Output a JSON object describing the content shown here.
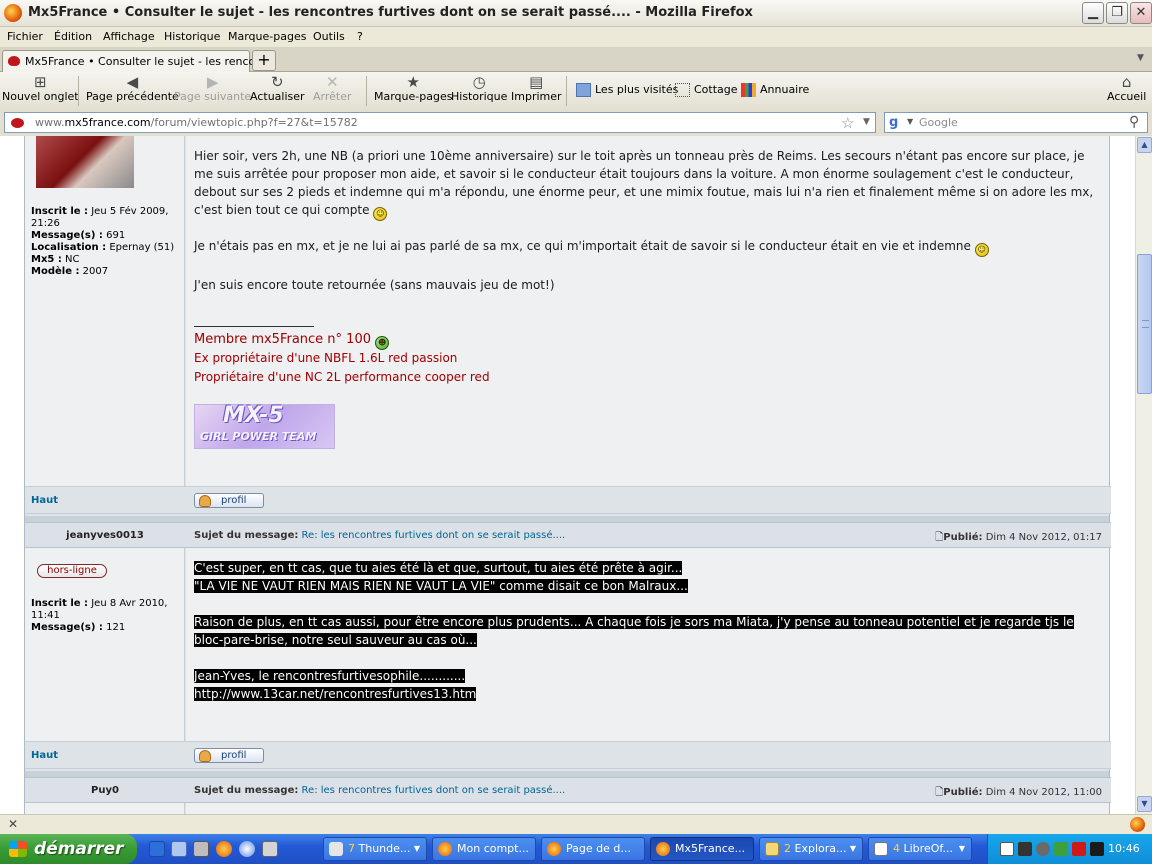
{
  "window": {
    "title": "Mx5France • Consulter le sujet - les rencontres furtives dont on se serait passé.... - Mozilla Firefox"
  },
  "menu": [
    "Fichier",
    "Édition",
    "Affichage",
    "Historique",
    "Marque-pages",
    "Outils",
    "?"
  ],
  "tabs": [
    {
      "label": "Mx5France • Consulter le sujet - les rencont..."
    }
  ],
  "toolbar": {
    "new_tab": "Nouvel onglet",
    "back": "Page précédente",
    "forward": "Page suivante",
    "reload": "Actualiser",
    "stop": "Arrêter",
    "bookmarks": "Marque-pages",
    "history": "Historique",
    "print": "Imprimer",
    "most_visited": "Les plus visités",
    "cottage": "Cottage",
    "annuaire": "Annuaire",
    "home": "Accueil"
  },
  "urlbar": {
    "url_prefix": "www.",
    "url_domain": "mx5france.com",
    "url_path": "/forum/viewtopic.php?f=27&t=15782",
    "search_placeholder": "Google"
  },
  "post1": {
    "profile": {
      "inscrit_label": "Inscrit le :",
      "inscrit_value": "Jeu 5 Fév 2009, 21:26",
      "messages_label": "Message(s) :",
      "messages_value": "691",
      "localisation_label": "Localisation :",
      "localisation_value": "Epernay (51)",
      "mx5_label": "Mx5 :",
      "mx5_value": "NC",
      "modele_label": "Modèle :",
      "modele_value": "2007"
    },
    "paragraphs": [
      "Hier soir, vers 2h, une NB (a priori une 10ème anniversaire) sur le toit après un tonneau près de Reims. Les secours n'étant pas encore sur place, je me suis arrêtée pour proposer mon aide, et savoir si le conducteur était toujours dans la voiture. A mon énorme soulagement c'est le conducteur, debout sur ses 2 pieds et indemne qui m'a répondu, une énorme peur, et une mimix foutue, mais lui n'a rien et finalement même si on adore les mx, c'est bien tout ce qui compte",
      "Je n'étais pas en mx, et je ne lui ai pas parlé de sa mx, ce qui m'importait était de savoir si le conducteur était en vie et indemne",
      "J'en suis encore toute retournée (sans mauvais jeu de mot!)"
    ],
    "signature": {
      "line1": "Membre mx5France n° 100",
      "line2": "Ex propriétaire d'une NBFL 1.6L red passion",
      "line3": "Propriétaire d'une NC 2L performance cooper red",
      "logo_text_1": "MX-5",
      "logo_text_2": "GIRL POWER TEAM"
    },
    "haut": "Haut",
    "profil": "profil"
  },
  "post2": {
    "author": "jeanyves0013",
    "subject_label": "Sujet du message:",
    "subject_value": "Re: les rencontres furtives dont on se serait passé....",
    "published_label": "Publié:",
    "published_value": "Dim 4 Nov 2012, 01:17",
    "status": "hors-ligne",
    "profile": {
      "inscrit_label": "Inscrit le :",
      "inscrit_value": "Jeu 8 Avr 2010, 11:41",
      "messages_label": "Message(s) :",
      "messages_value": "121"
    },
    "lines": [
      "C'est super, en tt cas, que tu aies été là et que, surtout, tu aies été prête à agir...",
      "\"LA VIE NE VAUT RIEN MAIS RIEN NE VAUT LA VIE\" comme disait ce bon Malraux...",
      "Raison de plus, en tt cas aussi, pour être encore plus prudents... A chaque fois je sors ma Miata, j'y pense au tonneau potentiel et je regarde tjs le",
      "bloc-pare-brise, notre seul sauveur au cas où...",
      "Jean-Yves, le rencontresfurtivesophile............",
      "http://www.13car.net/rencontresfurtives13.htm"
    ],
    "haut": "Haut",
    "profil": "profil"
  },
  "post3": {
    "author": "Puy0",
    "subject_label": "Sujet du message:",
    "subject_value": "Re: les rencontres furtives dont on se serait passé....",
    "published_label": "Publié:",
    "published_value": "Dim 4 Nov 2012, 11:00"
  },
  "taskbar": {
    "start": "démarrer",
    "tasks": [
      {
        "label": "Thunde...",
        "count": "7"
      },
      {
        "label": "Mon compt..."
      },
      {
        "label": "Page de d..."
      },
      {
        "label": "Mx5France..."
      },
      {
        "label": "Explora...",
        "count": "2"
      },
      {
        "label": "LibreOf...",
        "count": "4"
      }
    ],
    "clock": "10:46"
  },
  "colors": {
    "accent": "#006597",
    "signature_red": "#a00000",
    "taskbar_blue": "#2459d6",
    "start_green": "#389c34"
  }
}
